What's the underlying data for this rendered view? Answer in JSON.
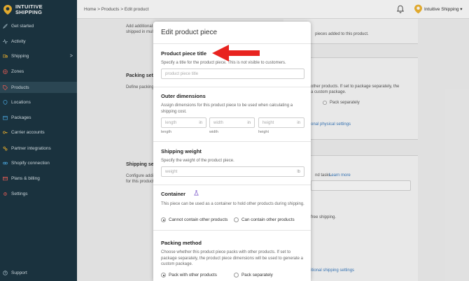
{
  "app": {
    "logo_line1": "INTUITIVE",
    "logo_line2": "SHIPPING"
  },
  "breadcrumb": "Home > Products > Edit product",
  "user": {
    "name": "Intuitive Shipping ▾"
  },
  "sidebar": {
    "items": [
      {
        "label": "Get started",
        "icon": "rocket-icon"
      },
      {
        "label": "Activity",
        "icon": "activity-icon"
      },
      {
        "label": "Shipping",
        "icon": "truck-icon"
      },
      {
        "label": "Zones",
        "icon": "globe-icon"
      },
      {
        "label": "Products",
        "icon": "tag-icon"
      },
      {
        "label": "Locations",
        "icon": "location-icon"
      },
      {
        "label": "Packages",
        "icon": "package-icon"
      },
      {
        "label": "Carrier accounts",
        "icon": "key-icon"
      },
      {
        "label": "Partner integrations",
        "icon": "partner-icon"
      },
      {
        "label": "Shopify connection",
        "icon": "link-icon"
      },
      {
        "label": "Plans & billing",
        "icon": "billing-icon"
      },
      {
        "label": "Settings",
        "icon": "gear-icon"
      },
      {
        "label": "Support",
        "icon": "help-icon"
      }
    ],
    "shipping_chevron": ">"
  },
  "background": {
    "add_additional": "Add additional",
    "shipped_in_multi": "shipped in multi",
    "pieces_added": "pieces added to this product.",
    "packing_settings": "Packing sett",
    "define_packing": "Define packing",
    "pack_sep_text_1": "other products. If set to package separately, the",
    "pack_sep_text_2": "a custom package.",
    "pack_separately": "Pack separately",
    "physical_settings": "onal physical settings",
    "shipping_settings": "Shipping se",
    "configure_addl": "Configure addit",
    "for_this_product": "for this product",
    "rand_tasks": "nd tasks.",
    "learn_more": "Learn more",
    "free_shipping": "free shipping.",
    "ional_shipping": "itional shipping settings"
  },
  "modal": {
    "title": "Edit product piece",
    "title_section": {
      "heading": "Product piece title",
      "desc": "Specify a title for the product piece. This is not visible to customers.",
      "placeholder": "product piece title"
    },
    "dimensions": {
      "heading": "Outer dimensions",
      "desc": "Assign dimensions for this product piece to be used when calculating a shipping cost.",
      "fields": [
        {
          "placeholder": "length",
          "unit": "in",
          "caption": "length"
        },
        {
          "placeholder": "width",
          "unit": "in",
          "caption": "width"
        },
        {
          "placeholder": "height",
          "unit": "in",
          "caption": "height"
        }
      ]
    },
    "weight": {
      "heading": "Shipping weight",
      "desc": "Specify the weight of the product piece.",
      "placeholder": "weight",
      "unit": "lb"
    },
    "container": {
      "heading": "Container",
      "desc": "This piece can be used as a container to hold other products during shipping.",
      "options": [
        "Cannot contain other products",
        "Can contain other products"
      ],
      "selected": 0
    },
    "packing": {
      "heading": "Packing method",
      "desc": "Choose whether this product piece packs with other products. If set to package separately, the product piece dimensions will be used to generate a custom package.",
      "options": [
        "Pack with other products",
        "Pack separately"
      ],
      "selected": 0
    }
  },
  "colors": {
    "sidebar_bg": "#1c3643",
    "accent": "#f2b632",
    "arrow": "#e8231f",
    "link": "#3a7bbf"
  }
}
